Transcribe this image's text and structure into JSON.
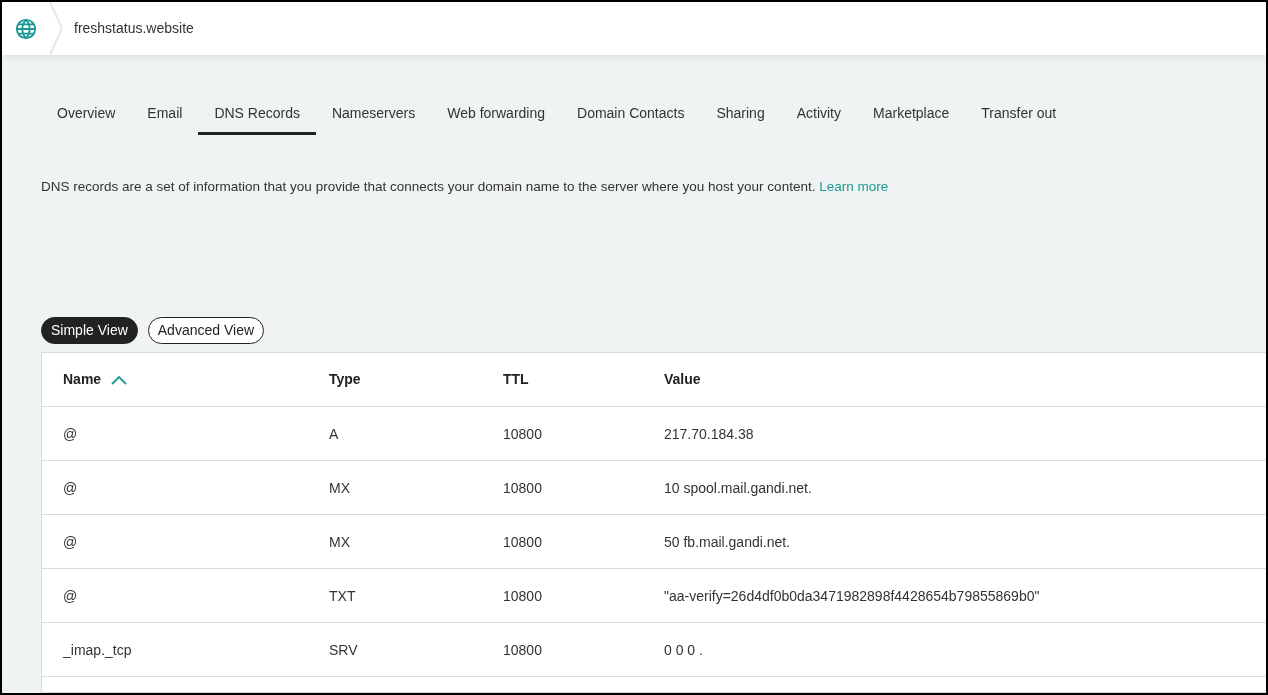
{
  "header": {
    "domain": "freshstatus.website"
  },
  "tabs": [
    {
      "label": "Overview",
      "selected": false
    },
    {
      "label": "Email",
      "selected": false
    },
    {
      "label": "DNS Records",
      "selected": true
    },
    {
      "label": "Nameservers",
      "selected": false
    },
    {
      "label": "Web forwarding",
      "selected": false
    },
    {
      "label": "Domain Contacts",
      "selected": false
    },
    {
      "label": "Sharing",
      "selected": false
    },
    {
      "label": "Activity",
      "selected": false
    },
    {
      "label": "Marketplace",
      "selected": false
    },
    {
      "label": "Transfer out",
      "selected": false
    }
  ],
  "description": {
    "text": "DNS records are a set of information that you provide that connects your domain name to the server where you host your content.",
    "link": "Learn more"
  },
  "views": [
    {
      "label": "Simple View",
      "selected": true
    },
    {
      "label": "Advanced View",
      "selected": false
    }
  ],
  "table": {
    "columns": [
      "Name",
      "Type",
      "TTL",
      "Value"
    ],
    "rows": [
      [
        "@",
        "A",
        "10800",
        "217.70.184.38"
      ],
      [
        "@",
        "MX",
        "10800",
        "10 spool.mail.gandi.net."
      ],
      [
        "@",
        "MX",
        "10800",
        "50 fb.mail.gandi.net."
      ],
      [
        "@",
        "TXT",
        "10800",
        "\"aa-verify=26d4df0b0da3471982898f4428654b79855869b0\""
      ],
      [
        "_imap._tcp",
        "SRV",
        "10800",
        "0 0 0 ."
      ]
    ]
  }
}
